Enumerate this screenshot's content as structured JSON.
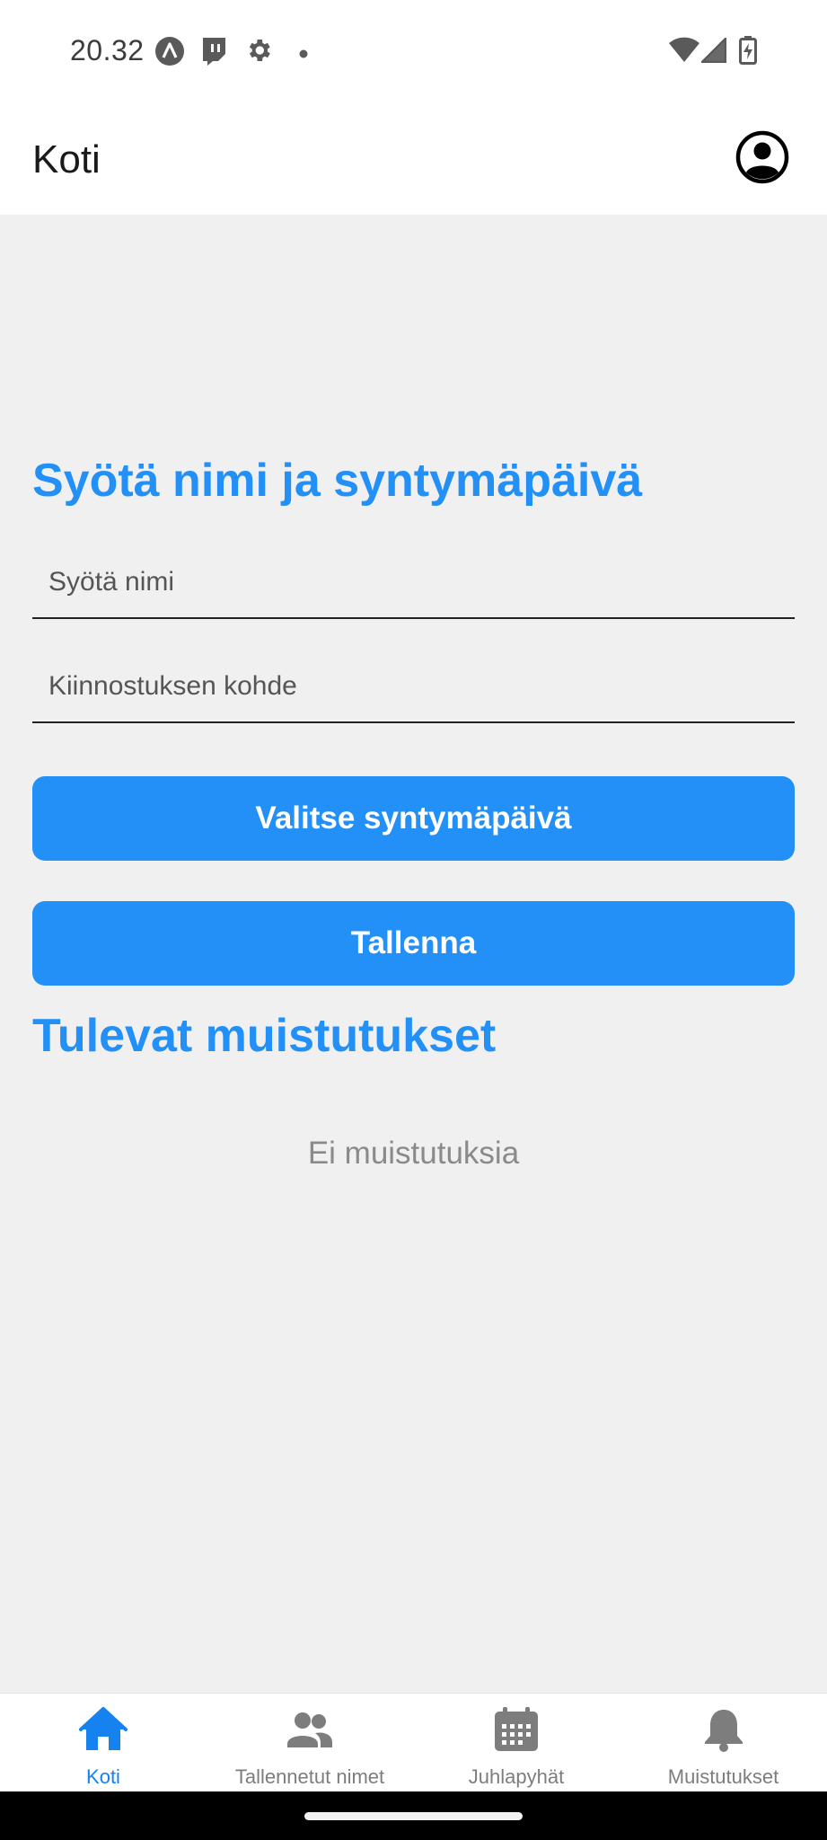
{
  "status_bar": {
    "time": "20.32",
    "left_icons": [
      "app-a-icon",
      "twitch-icon",
      "gear-icon",
      "dot-icon"
    ],
    "right_icons": [
      "wifi-icon",
      "cell-signal-icon",
      "battery-charging-icon"
    ]
  },
  "app_bar": {
    "title": "Koti",
    "profile_icon": "account-circle-icon"
  },
  "form": {
    "title": "Syötä nimi ja syntymäpäivä",
    "name_placeholder": "Syötä nimi",
    "name_value": "",
    "interest_placeholder": "Kiinnostuksen kohde",
    "interest_value": "",
    "birthday_button_label": "Valitse syntymäpäivä",
    "save_button_label": "Tallenna"
  },
  "reminders": {
    "title": "Tulevat muistutukset",
    "empty_text": "Ei muistutuksia"
  },
  "bottom_nav": {
    "items": [
      {
        "label": "Koti",
        "icon": "home-icon",
        "active": true
      },
      {
        "label": "Tallennetut nimet",
        "icon": "people-icon",
        "active": false
      },
      {
        "label": "Juhlapyhät",
        "icon": "calendar-icon",
        "active": false
      },
      {
        "label": "Muistutukset",
        "icon": "bell-icon",
        "active": false
      }
    ]
  },
  "colors": {
    "accent": "#2290f7",
    "active_tab": "#1682f0",
    "inactive_tab": "#7d7d7d",
    "background": "#f0f0f0"
  }
}
